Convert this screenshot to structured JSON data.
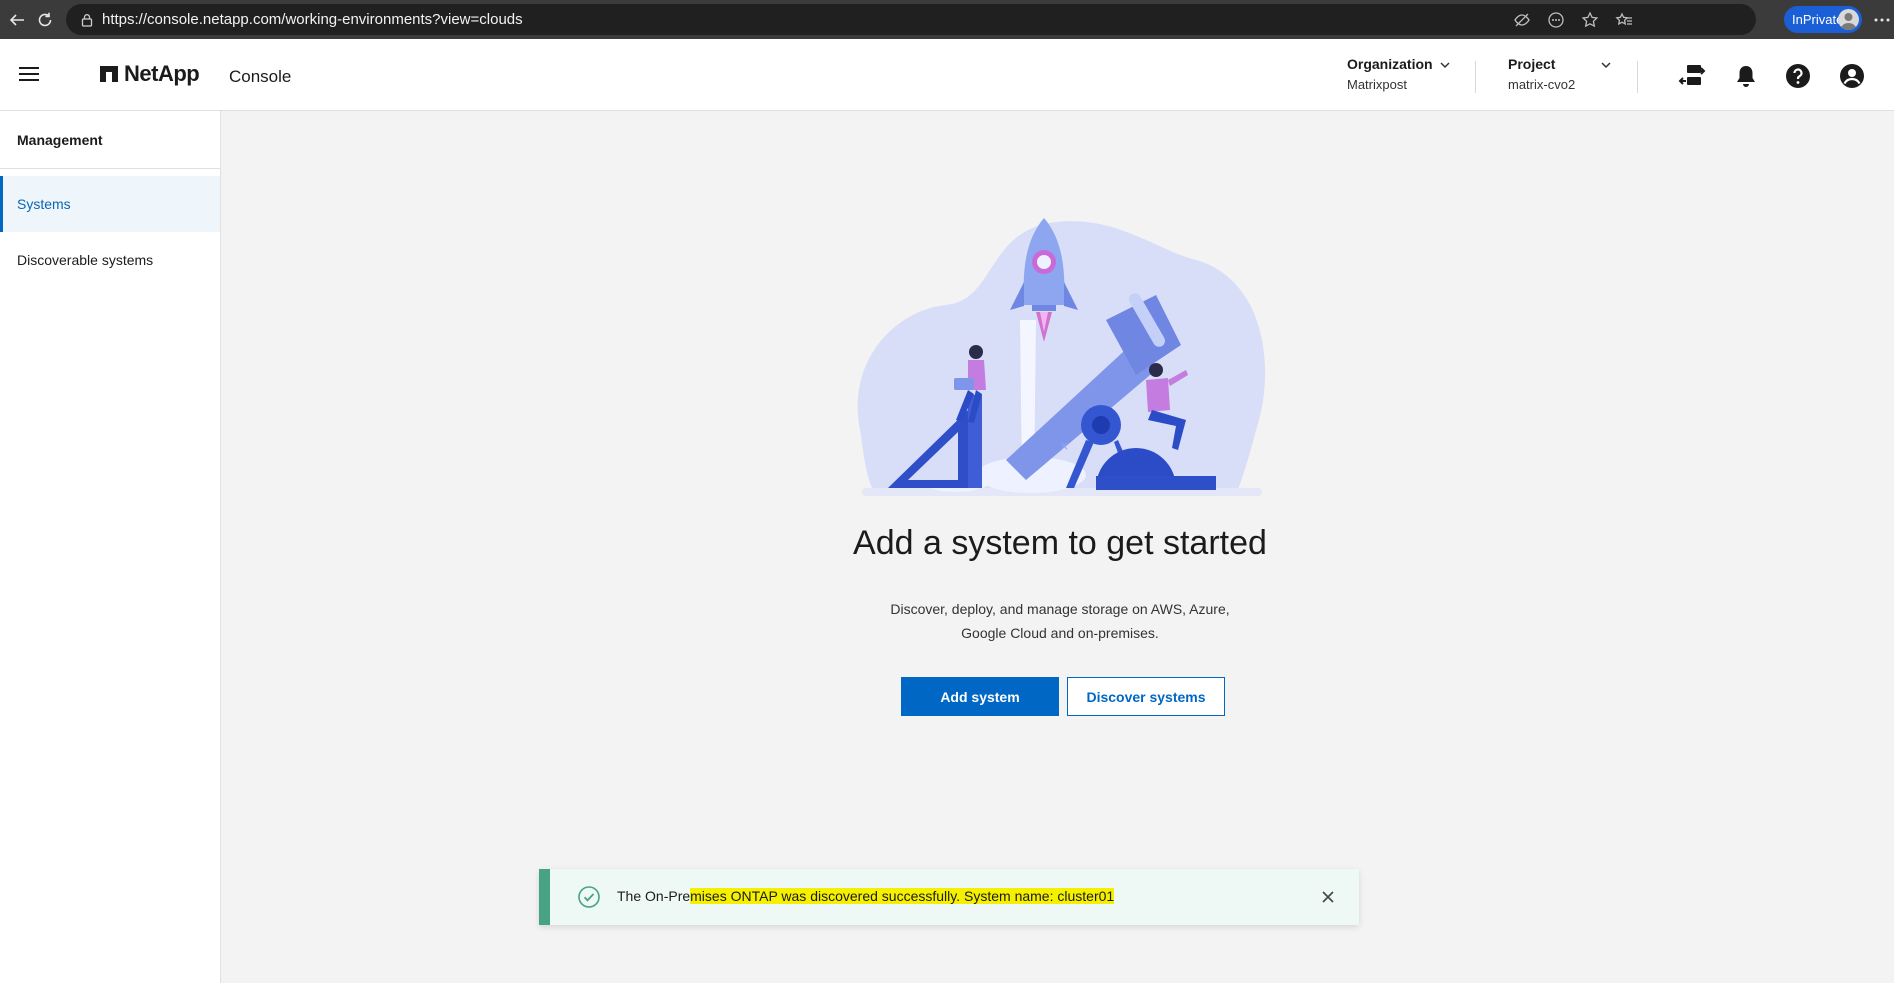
{
  "browser": {
    "url": "https://console.netapp.com/working-environments?view=clouds",
    "inprivate_label": "InPrivate",
    "icons": [
      "back-icon",
      "refresh-icon",
      "lock-icon",
      "tracking-icon",
      "reader-icon",
      "favorite-star-icon",
      "favorites-icon",
      "more-icon"
    ]
  },
  "header": {
    "brand": "NetApp",
    "app_name": "Console",
    "organization": {
      "label": "Organization",
      "value": "Matrixpost"
    },
    "project": {
      "label": "Project",
      "value": "matrix-cvo2"
    },
    "icons": [
      "connector-icon",
      "bell-icon",
      "help-icon",
      "account-icon"
    ]
  },
  "sidebar": {
    "heading": "Management",
    "items": [
      {
        "label": "Systems",
        "active": true
      },
      {
        "label": "Discoverable systems",
        "active": false
      }
    ]
  },
  "main": {
    "title": "Add a system to get started",
    "description_line1": "Discover, deploy, and manage storage on AWS, Azure,",
    "description_line2": "Google Cloud and on-premises.",
    "primary_button": "Add system",
    "secondary_button": "Discover systems"
  },
  "toast": {
    "text_prefix": "The On-Pre",
    "text_highlight": "mises ONTAP was discovered successfully. System name: cluster01",
    "status": "success"
  },
  "colors": {
    "accent": "#0067c5",
    "browser_bar": "#3b3b3b",
    "toast_success": "#47a382",
    "highlight": "#f5f000"
  }
}
